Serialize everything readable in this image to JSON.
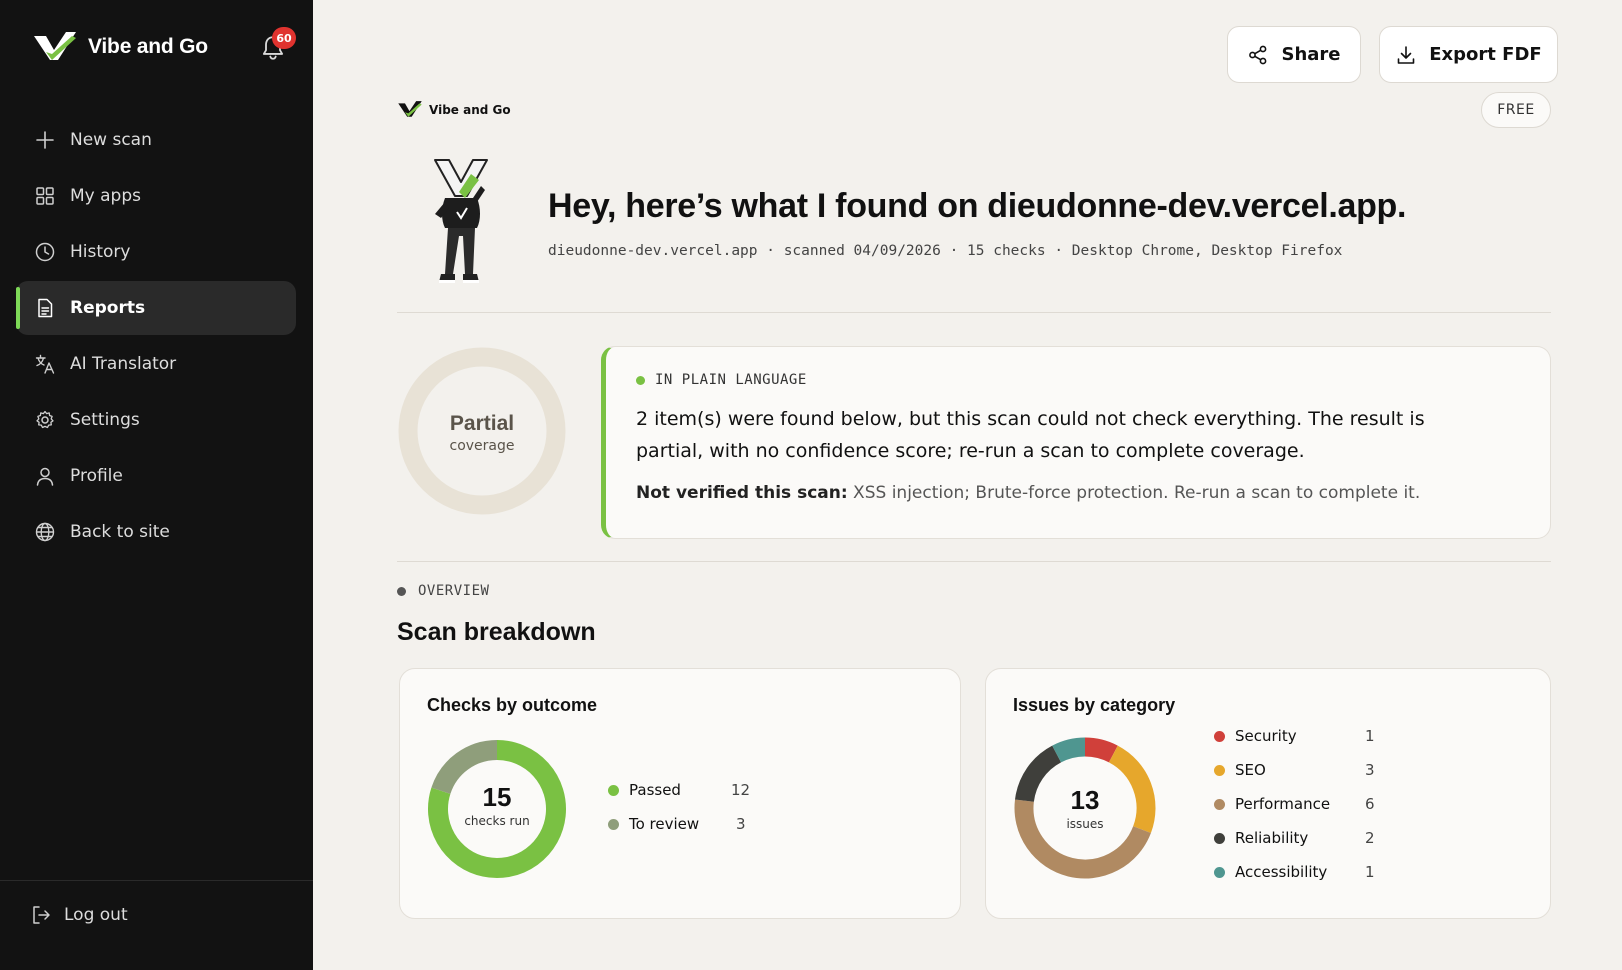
{
  "sidebar": {
    "brand_name": "Vibe and Go",
    "notification_count": "60",
    "items": [
      {
        "label": "New scan",
        "icon": "plus-icon"
      },
      {
        "label": "My apps",
        "icon": "grid-icon"
      },
      {
        "label": "History",
        "icon": "clock-icon"
      },
      {
        "label": "Reports",
        "icon": "document-icon",
        "active": true
      },
      {
        "label": "AI Translator",
        "icon": "translate-icon"
      },
      {
        "label": "Settings",
        "icon": "gear-icon"
      },
      {
        "label": "Profile",
        "icon": "user-icon"
      },
      {
        "label": "Back to site",
        "icon": "globe-icon"
      }
    ],
    "logout_label": "Log out"
  },
  "toolbar": {
    "share_label": "Share",
    "export_label": "Export FDF"
  },
  "report": {
    "brand_name": "Vibe and Go",
    "plan_badge": "FREE",
    "headline": "Hey, here’s what I found on dieudonne-dev.vercel.app.",
    "meta": "dieudonne-dev.vercel.app · scanned 04/09/2026 · 15 checks · Desktop Chrome, Desktop Firefox"
  },
  "coverage": {
    "title": "Partial",
    "subtitle": "coverage"
  },
  "plain_language": {
    "label": "IN PLAIN LANGUAGE",
    "body": "2 item(s) were found below, but this scan could not check everything. The result is partial, with no confidence score; re-run a scan to complete coverage.",
    "note_label": "Not verified this scan:",
    "note_text": " XSS injection; Brute-force protection. Re-run a scan to complete it."
  },
  "overview": {
    "label": "OVERVIEW",
    "title": "Scan breakdown"
  },
  "colors": {
    "accent_green": "#7ac143",
    "passed": "#7ac143",
    "to_review": "#8f9e7b",
    "security": "#d0403a",
    "seo": "#e6a72c",
    "performance": "#b08a62",
    "reliability": "#3f3f3b",
    "accessibility": "#4f9690"
  },
  "outcome": {
    "title": "Checks by outcome",
    "total": "15",
    "total_label": "checks run",
    "items": [
      {
        "label": "Passed",
        "value": 12,
        "color": "#7ac143"
      },
      {
        "label": "To review",
        "value": 3,
        "color": "#8f9e7b"
      }
    ]
  },
  "category": {
    "title": "Issues by category",
    "total": "13",
    "total_label": "issues",
    "items": [
      {
        "label": "Security",
        "value": 1,
        "color": "#d0403a"
      },
      {
        "label": "SEO",
        "value": 3,
        "color": "#e6a72c"
      },
      {
        "label": "Performance",
        "value": 6,
        "color": "#b08a62"
      },
      {
        "label": "Reliability",
        "value": 2,
        "color": "#3f3f3b"
      },
      {
        "label": "Accessibility",
        "value": 1,
        "color": "#4f9690"
      }
    ]
  }
}
